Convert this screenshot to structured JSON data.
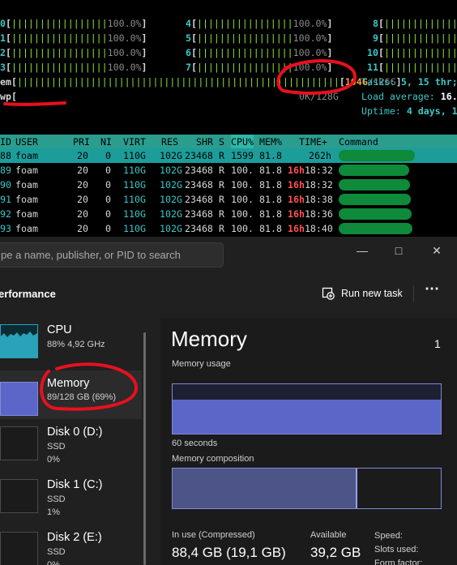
{
  "terminal": {
    "cpu_rows": [
      {
        "c1_id": "0",
        "c1_pct": "100.0%",
        "c2_id": "4",
        "c2_pct": "100.0%",
        "c3_id": "8"
      },
      {
        "c1_id": "1",
        "c1_pct": "100.0%",
        "c2_id": "5",
        "c2_pct": "100.0%",
        "c3_id": "9"
      },
      {
        "c1_id": "2",
        "c1_pct": "100.0%",
        "c2_id": "6",
        "c2_pct": "100.0%",
        "c3_id": "10"
      },
      {
        "c1_id": "3",
        "c1_pct": "100.0%",
        "c2_id": "7",
        "c2_pct": "100.0%",
        "c3_id": "11"
      }
    ],
    "mem_label": "em",
    "mem_used": "104G",
    "mem_total": "126G",
    "swp_label": "wp",
    "swp_value": "0K/128G",
    "tasks_label": "Tasks: ",
    "tasks_value": "5, 15 thr;",
    "load_label": "Load average: ",
    "load_value": "16.",
    "uptime_label": "Uptime: ",
    "uptime_value": "4 days, 1",
    "columns": {
      "pid": "ID",
      "user": "USER",
      "pri": "PRI",
      "ni": "NI",
      "virt": "VIRT",
      "res": "RES",
      "shr": "SHR",
      "s": "S",
      "cpu": "CPU%",
      "mem": "MEM%",
      "time": "TIME+",
      "cmd": "Command"
    },
    "processes": [
      {
        "pid": "88",
        "user": "foam",
        "pri": "20",
        "ni": "0",
        "virt": "110G",
        "res": "102G",
        "shr": "23468",
        "s": "R",
        "cpu": "1599",
        "mem": "81.8",
        "time_h": "",
        "time_rest": "262h"
      },
      {
        "pid": "89",
        "user": "foam",
        "pri": "20",
        "ni": "0",
        "virt": "110G",
        "res": "102G",
        "shr": "23468",
        "s": "R",
        "cpu": "100.",
        "mem": "81.8",
        "time_h": "16h",
        "time_rest": "18:32"
      },
      {
        "pid": "90",
        "user": "foam",
        "pri": "20",
        "ni": "0",
        "virt": "110G",
        "res": "102G",
        "shr": "23468",
        "s": "R",
        "cpu": "100.",
        "mem": "81.8",
        "time_h": "16h",
        "time_rest": "18:32"
      },
      {
        "pid": "91",
        "user": "foam",
        "pri": "20",
        "ni": "0",
        "virt": "110G",
        "res": "102G",
        "shr": "23468",
        "s": "R",
        "cpu": "100.",
        "mem": "81.8",
        "time_h": "16h",
        "time_rest": "18:38"
      },
      {
        "pid": "92",
        "user": "foam",
        "pri": "20",
        "ni": "0",
        "virt": "110G",
        "res": "102G",
        "shr": "23468",
        "s": "R",
        "cpu": "100.",
        "mem": "81.8",
        "time_h": "16h",
        "time_rest": "18:36"
      },
      {
        "pid": "93",
        "user": "foam",
        "pri": "20",
        "ni": "0",
        "virt": "110G",
        "res": "102G",
        "shr": "23468",
        "s": "R",
        "cpu": "100.",
        "mem": "81.8",
        "time_h": "16h",
        "time_rest": "18:40"
      }
    ]
  },
  "taskmgr": {
    "search_placeholder": "pe a name, publisher, or PID to search",
    "page_title": "erformance",
    "run_new_task": "Run new task",
    "sidebar": [
      {
        "name": "CPU",
        "sub1": "88% 4,92 GHz",
        "sub2": ""
      },
      {
        "name": "Memory",
        "sub1": "89/128 GB (69%)",
        "sub2": ""
      },
      {
        "name": "Disk 0 (D:)",
        "sub1": "SSD",
        "sub2": "0%"
      },
      {
        "name": "Disk 1 (C:)",
        "sub1": "SSD",
        "sub2": "1%"
      },
      {
        "name": "Disk 2 (E:)",
        "sub1": "SSD",
        "sub2": "0%"
      }
    ],
    "memory": {
      "title": "Memory",
      "title_right": "1",
      "usage_label": "Memory usage",
      "usage_fraction": 0.69,
      "axis_label": "60 seconds",
      "composition_label": "Memory composition",
      "composition_fraction": 0.69,
      "in_use_label": "In use (Compressed)",
      "in_use_value": "88,4 GB (19,1 GB)",
      "available_label": "Available",
      "available_value": "39,2 GB",
      "speed_label": "Speed:",
      "slots_label": "Slots used:",
      "form_label": "Form factor:"
    }
  },
  "colors": {
    "annotation": "#e8101e",
    "htop_cyan": "#39c8c8",
    "htop_green": "#8ae234",
    "header_bg": "#2a9d8f",
    "tm_accent": "#5c66c8"
  }
}
